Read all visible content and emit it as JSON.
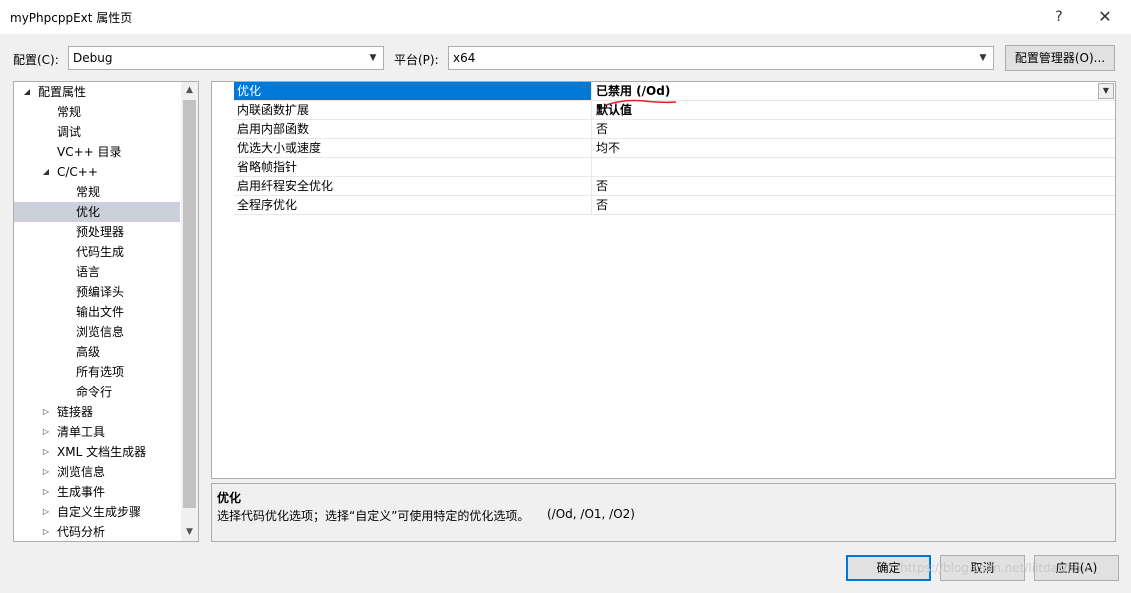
{
  "window": {
    "title": "myPhpcppExt 属性页",
    "help_glyph": "?",
    "close_glyph": "✕"
  },
  "config_bar": {
    "config_label": "配置(C):",
    "config_value": "Debug",
    "platform_label": "平台(P):",
    "platform_value": "x64",
    "manager_button": "配置管理器(O)..."
  },
  "tree": {
    "items": [
      {
        "label": "配置属性",
        "expander": "◢"
      },
      {
        "label": "常规"
      },
      {
        "label": "调试"
      },
      {
        "label": "VC++ 目录"
      },
      {
        "label": "C/C++",
        "expander": "◢"
      },
      {
        "label": "常规"
      },
      {
        "label": "优化",
        "selected": true
      },
      {
        "label": "预处理器"
      },
      {
        "label": "代码生成"
      },
      {
        "label": "语言"
      },
      {
        "label": "预编译头"
      },
      {
        "label": "输出文件"
      },
      {
        "label": "浏览信息"
      },
      {
        "label": "高级"
      },
      {
        "label": "所有选项"
      },
      {
        "label": "命令行"
      },
      {
        "label": "链接器",
        "expander": "▷"
      },
      {
        "label": "清单工具",
        "expander": "▷"
      },
      {
        "label": "XML 文档生成器",
        "expander": "▷"
      },
      {
        "label": "浏览信息",
        "expander": "▷"
      },
      {
        "label": "生成事件",
        "expander": "▷"
      },
      {
        "label": "自定义生成步骤",
        "expander": "▷"
      },
      {
        "label": "代码分析",
        "expander": "▷"
      }
    ]
  },
  "properties": {
    "rows": [
      {
        "name": "优化",
        "value": "已禁用 (/Od)",
        "selected": true
      },
      {
        "name": "内联函数扩展",
        "value": "默认值",
        "bold": true
      },
      {
        "name": "启用内部函数",
        "value": "否"
      },
      {
        "name": "优选大小或速度",
        "value": "均不"
      },
      {
        "name": "省略帧指针",
        "value": ""
      },
      {
        "name": "启用纤程安全优化",
        "value": "否"
      },
      {
        "name": "全程序优化",
        "value": "否"
      }
    ]
  },
  "description": {
    "title": "优化",
    "text": "选择代码优化选项；选择“自定义”可使用特定的优化选项。",
    "options": "(/Od, /O1, /O2)"
  },
  "buttons": {
    "ok": "确定",
    "cancel": "取消",
    "apply": "应用(A)"
  },
  "watermark": "https://blog.csdn.net/liitdar/linu",
  "colors": {
    "selection_blue": "#0078d7",
    "tree_selection": "#ccd0db",
    "annotation_red": "#e02020"
  }
}
